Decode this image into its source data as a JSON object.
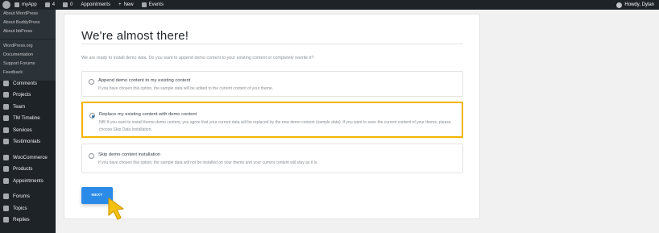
{
  "adminbar": {
    "site_name": "myApp",
    "updates_count": "4",
    "comments_count": "0",
    "appointments": "Appointments",
    "new": "New",
    "events": "Events",
    "howdy": "Howdy, Dylan"
  },
  "flyout": {
    "items": [
      "About WordPress",
      "About BuddyPress",
      "About bbPress",
      "WordPress.org",
      "Documentation",
      "Support Forums",
      "Feedback"
    ]
  },
  "menu": {
    "items": [
      "Comments",
      "Projects",
      "Team",
      "TM Timeline",
      "Services",
      "Testimonials",
      "WooCommerce",
      "Products",
      "Appointments",
      "Forums",
      "Topics",
      "Replies"
    ]
  },
  "page": {
    "title": "We're almost there!",
    "intro": "We are ready to install demo data. Do you want to append demo content to your existing content or completely rewrite it?",
    "options": [
      {
        "label": "Append demo content to my existing content",
        "desc": "If you have chosen this option, the sample data will be added to the current content of your theme.",
        "selected": false
      },
      {
        "label": "Replace my existing content with demo content",
        "desc": "NB! If you want to install theme demo content, you agree that your current data will be replaced by the new demo content (sample data). If you want to save the current content of your theme, please choose Skip Data Installation.",
        "selected": true
      },
      {
        "label": "Skip demo content installation",
        "desc": "If you have chosen this option, the sample data will not be installed on your theme and your current content will stay as it is.",
        "selected": false
      }
    ],
    "next_label": "NEXT"
  },
  "colors": {
    "highlight": "#f4b400",
    "button": "#2b8be8",
    "sidebar": "#1d2327"
  }
}
